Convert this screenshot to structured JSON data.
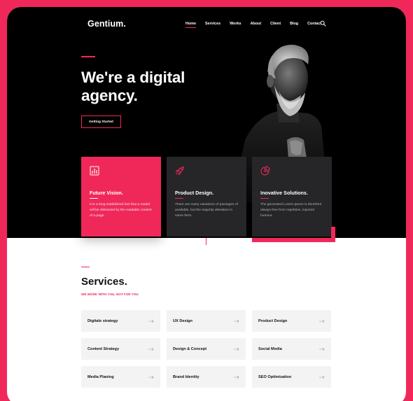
{
  "brand": {
    "logo": "Gentium.",
    "accent": "#f0285a"
  },
  "nav": {
    "items": [
      {
        "label": "Home",
        "active": true
      },
      {
        "label": "Services"
      },
      {
        "label": "Works"
      },
      {
        "label": "About"
      },
      {
        "label": "Client"
      },
      {
        "label": "Blog"
      },
      {
        "label": "Contact"
      }
    ],
    "search_icon": "search-icon"
  },
  "hero": {
    "title": "We're a digital agency.",
    "cta_label": "Getting Started"
  },
  "features": [
    {
      "icon": "chart-icon",
      "title": "Future Vision.",
      "text": "It is a long established fact that a reader will be distracted by the readable content of a page."
    },
    {
      "icon": "rocket-icon",
      "title": "Product Design.",
      "text": "There are many variations of passages of available, but the majority alteration in some form."
    },
    {
      "icon": "pie-chart-icon",
      "title": "Inovative Solutions.",
      "text": "The generated Lorem Ipsum is therefore always free from repetition, injected humour."
    }
  ],
  "services": {
    "title": "Services.",
    "subtitle": "WE WORK WITH YOU, NOT FOR YOU",
    "items": [
      "Digitale strategy",
      "UX Design",
      "Product Design",
      "Content Strategy",
      "Design & Concept",
      "Social Media",
      "Media Planing",
      "Brand Identity",
      "SEO Optimization"
    ],
    "arrow_icon": "arrow-right-icon"
  }
}
